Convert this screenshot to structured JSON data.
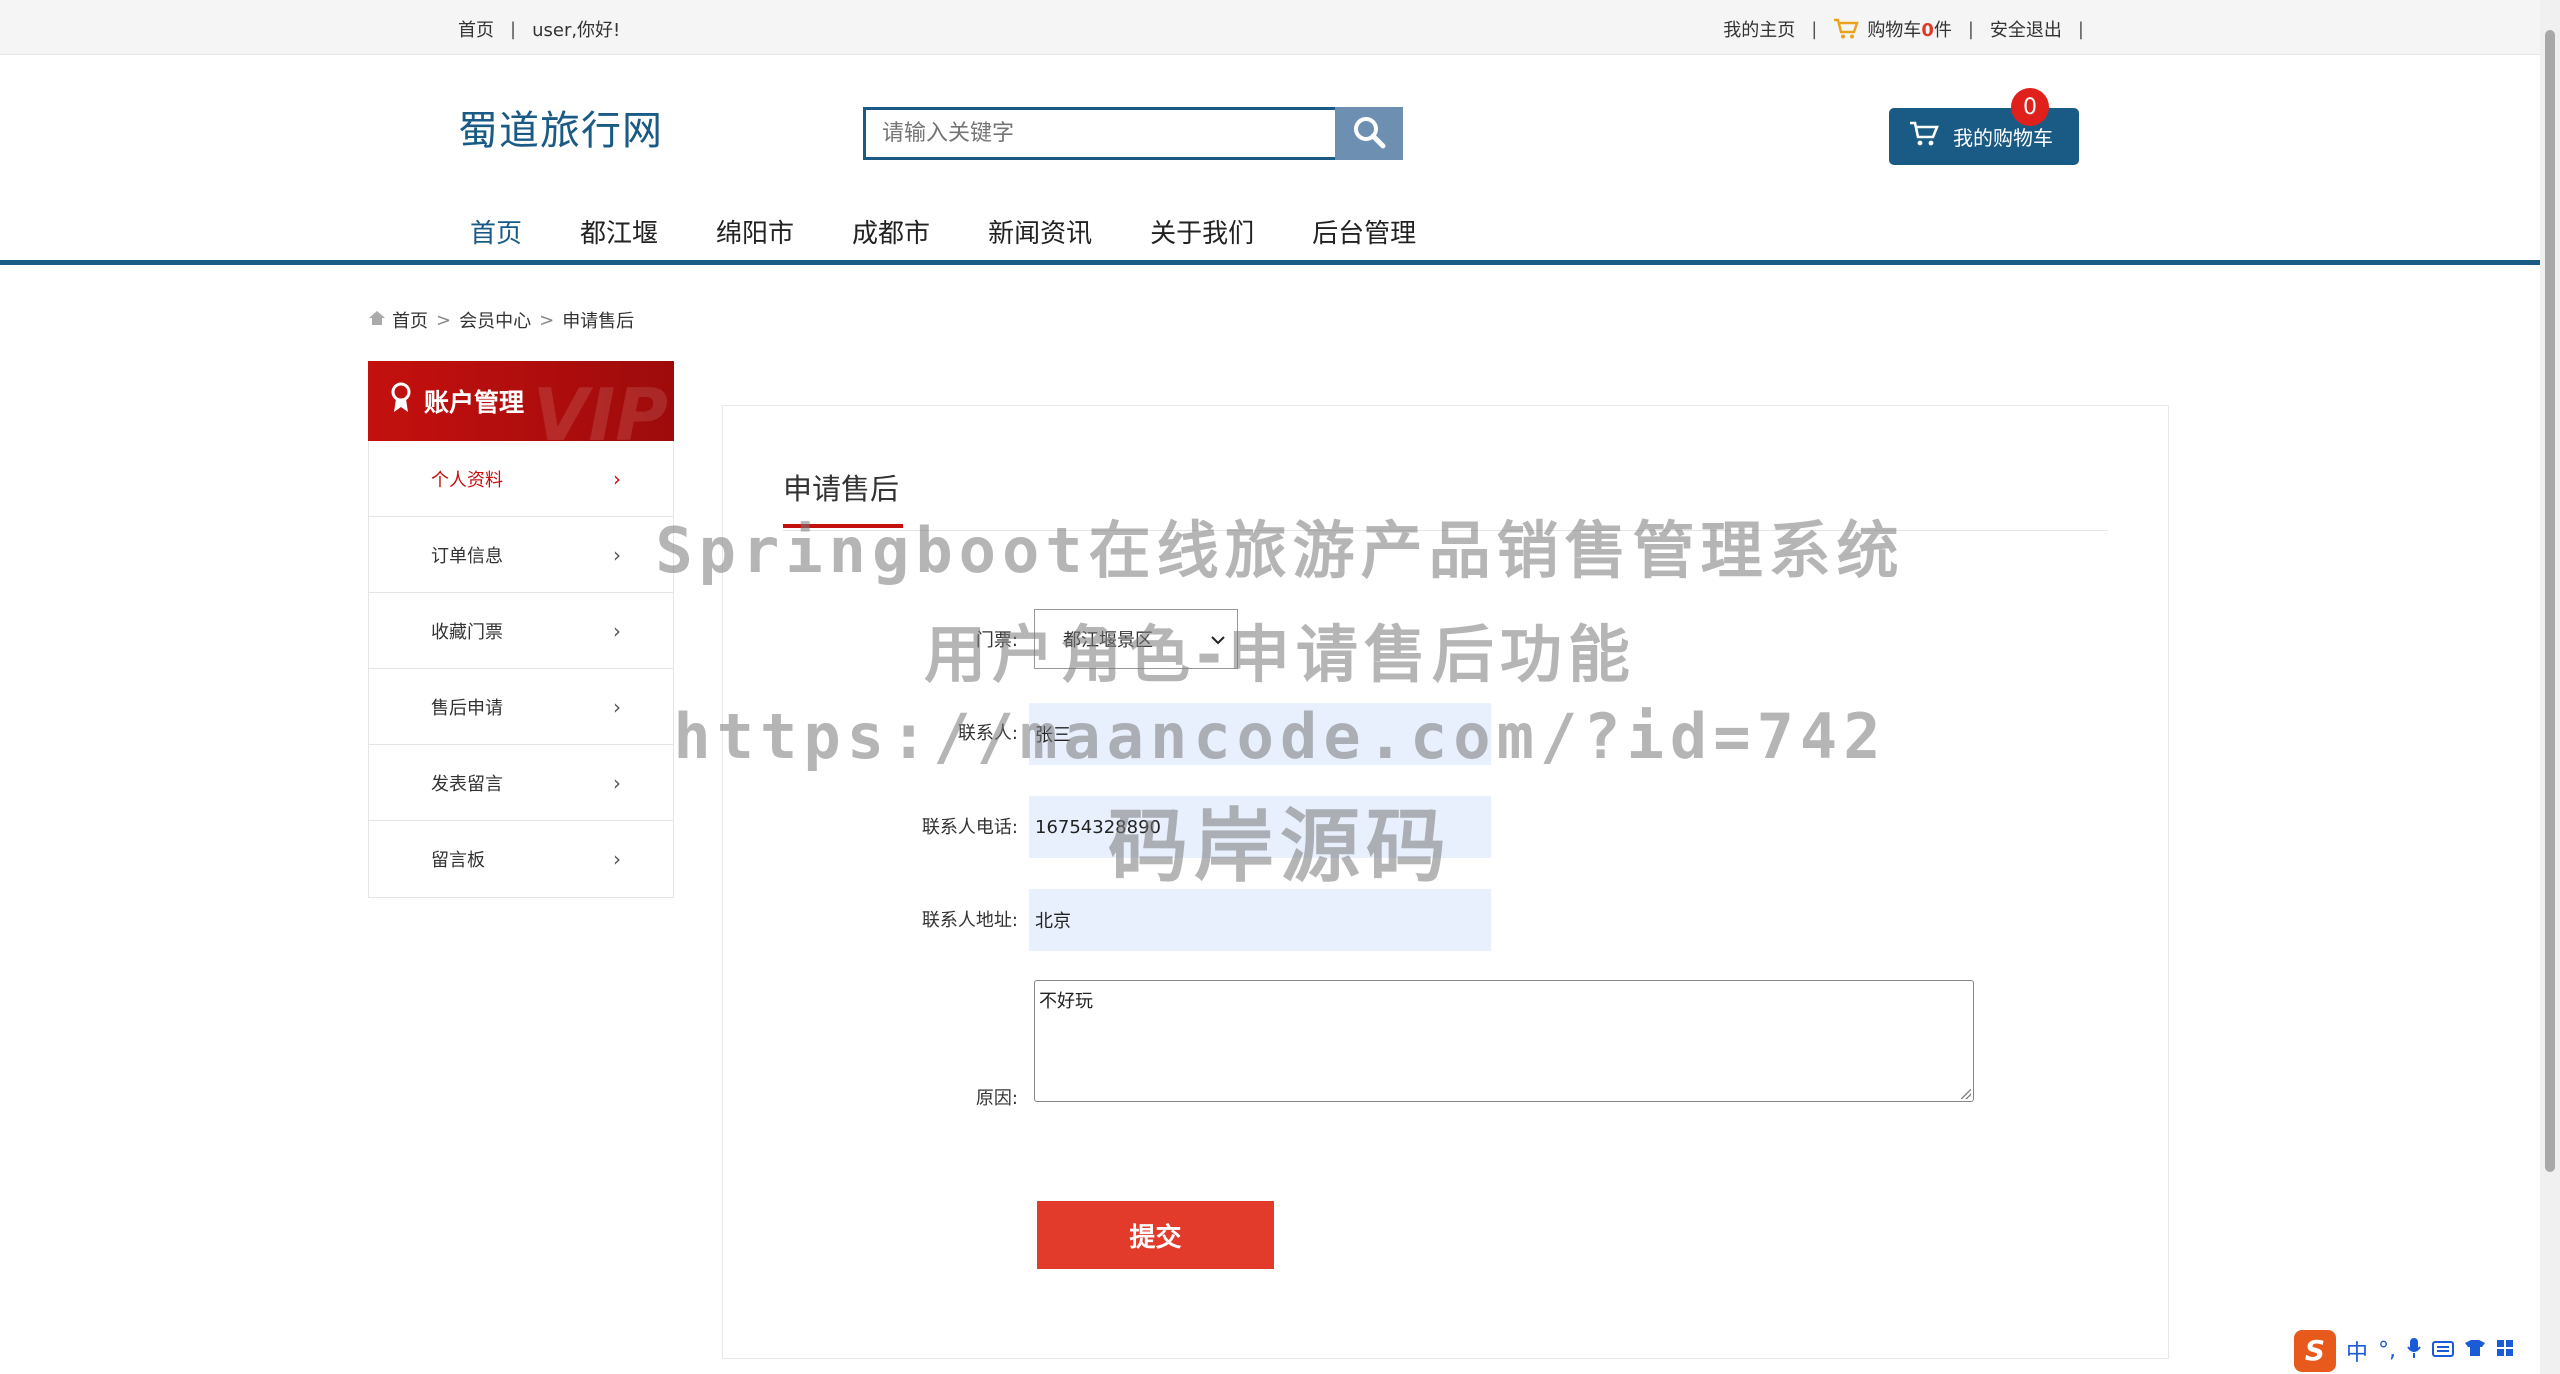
{
  "topbar": {
    "home": "首页",
    "sep": "|",
    "greeting": "user,你好!",
    "my_home": "我的主页",
    "cart_prefix": "购物车",
    "cart_count": "0",
    "cart_suffix": "件",
    "logout": "安全退出"
  },
  "header": {
    "logo": "蜀道旅行网",
    "search_placeholder": "请输入关键字",
    "my_cart": "我的购物车",
    "cart_badge": "0"
  },
  "nav": {
    "items": [
      "首页",
      "都江堰",
      "绵阳市",
      "成都市",
      "新闻资讯",
      "关于我们",
      "后台管理"
    ]
  },
  "breadcrumb": [
    "首页",
    "会员中心",
    "申请售后"
  ],
  "sidebar": {
    "title": "账户管理",
    "vip": "VIP",
    "items": [
      "个人资料",
      "订单信息",
      "收藏门票",
      "售后申请",
      "发表留言",
      "留言板"
    ]
  },
  "form": {
    "title": "申请售后",
    "ticket_label": "门票:",
    "ticket_value": "都江堰景区",
    "contact_label": "联系人:",
    "contact_value": "张三",
    "phone_label": "联系人电话:",
    "phone_value": "16754328890",
    "address_label": "联系人地址:",
    "address_value": "北京",
    "reason_label": "原因:",
    "reason_value": "不好玩",
    "submit": "提交"
  },
  "watermark": {
    "line1": "Springboot在线旅游产品销售管理系统",
    "line2": "用户角色-申请售后功能",
    "line3": "https://maancode.com/?id=742",
    "line4": "码岸源码"
  },
  "ime": {
    "logo": "S",
    "lang": "中"
  },
  "colors": {
    "brand": "#1a5b86",
    "accent": "#c4100f",
    "submit": "#e23a2b"
  }
}
